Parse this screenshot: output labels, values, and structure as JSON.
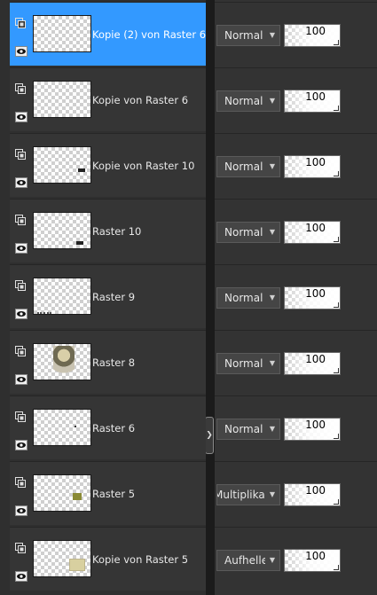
{
  "layers": [
    {
      "name": "Kopie (2) von Raster 6",
      "blend": "Normal",
      "opacity": "100",
      "selected": true
    },
    {
      "name": "Kopie von Raster 6",
      "blend": "Normal",
      "opacity": "100",
      "selected": false
    },
    {
      "name": "Kopie von Raster 10",
      "blend": "Normal",
      "opacity": "100",
      "selected": false
    },
    {
      "name": "Raster 10",
      "blend": "Normal",
      "opacity": "100",
      "selected": false
    },
    {
      "name": "Raster 9",
      "blend": "Normal",
      "opacity": "100",
      "selected": false
    },
    {
      "name": "Raster 8",
      "blend": "Normal",
      "opacity": "100",
      "selected": false
    },
    {
      "name": "Raster 6",
      "blend": "Normal",
      "opacity": "100",
      "selected": false
    },
    {
      "name": "Raster 5",
      "blend": "Multiplikation",
      "opacity": "100",
      "selected": false
    },
    {
      "name": "Kopie von Raster 5",
      "blend": "Aufhellen",
      "opacity": "100",
      "selected": false
    }
  ],
  "icons": {
    "group": "layer-group-icon",
    "visibility": "eye-icon",
    "dropdown": "chevron-down-icon",
    "splitter": "chevron-right-icon"
  },
  "colors": {
    "selected": "#3399ff",
    "panel": "#353535"
  }
}
